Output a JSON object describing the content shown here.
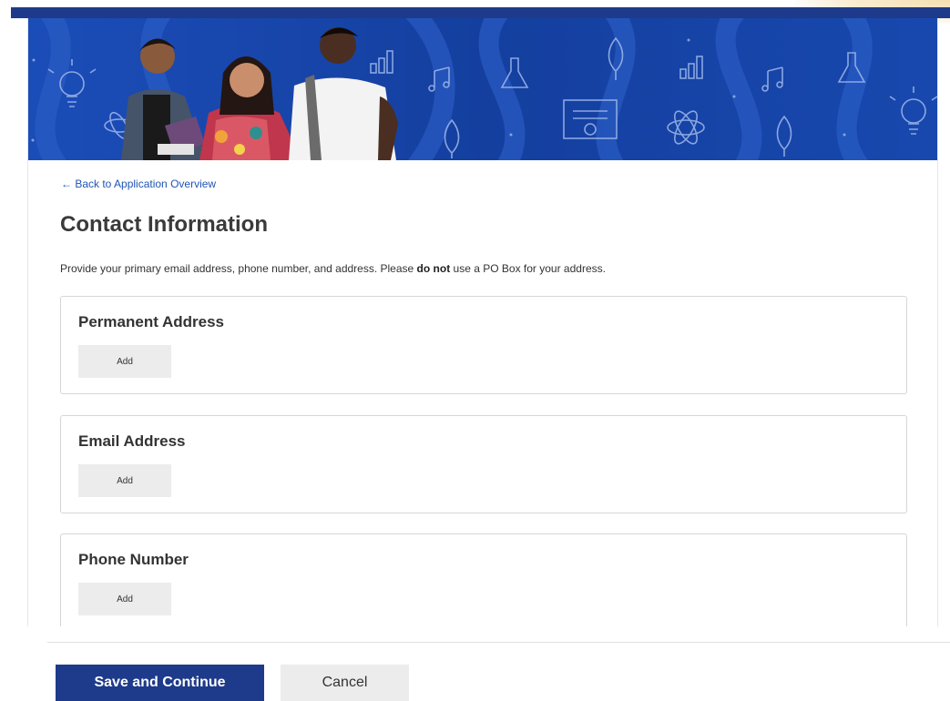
{
  "header": {
    "banner_image": "students-banner-image"
  },
  "navigation": {
    "back_link": "← Back to Application Overview"
  },
  "page": {
    "title": "Contact Information",
    "intro_before": "Provide your primary email address, phone number, and address. Please ",
    "intro_bold": "do not",
    "intro_after": " use a PO Box for your address."
  },
  "sections": [
    {
      "title": "Permanent Address",
      "add_label": "Add"
    },
    {
      "title": "Email Address",
      "add_label": "Add"
    },
    {
      "title": "Phone Number",
      "add_label": "Add"
    }
  ],
  "footer": {
    "save_label": "Save and Continue",
    "cancel_label": "Cancel"
  },
  "colors": {
    "brand_navy": "#1e3a8a",
    "banner_blue": "#1743a8",
    "link_blue": "#1f55b5",
    "button_gray": "#ececec"
  }
}
